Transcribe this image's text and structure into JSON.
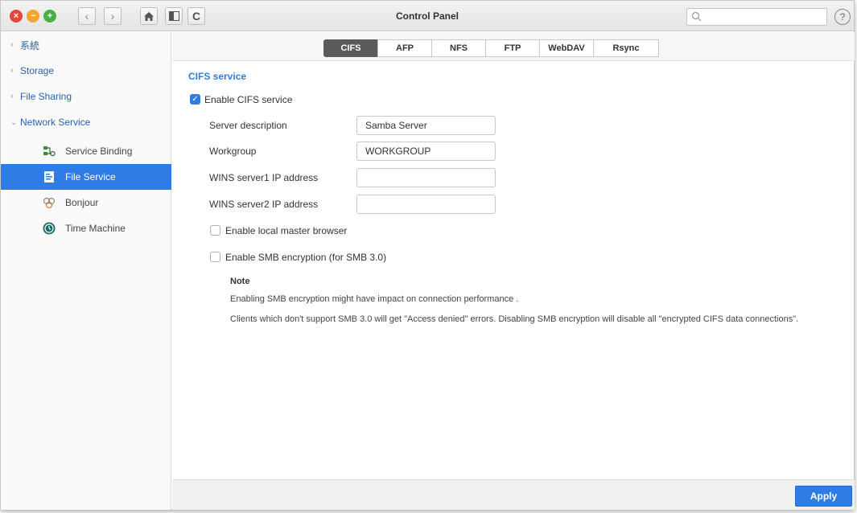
{
  "window": {
    "title": "Control Panel",
    "search_placeholder": "",
    "help_glyph": "?"
  },
  "titlebar": {
    "traffic": {
      "close": "×",
      "minimize": "−",
      "maximize": "+"
    },
    "buttons": {
      "back": "‹",
      "forward": "›",
      "refresh": "C"
    }
  },
  "sidebar": {
    "items": [
      {
        "label": "系統",
        "state": "collapsed"
      },
      {
        "label": "Storage",
        "state": "collapsed"
      },
      {
        "label": "File Sharing",
        "state": "collapsed"
      },
      {
        "label": "Network Service",
        "state": "expanded"
      }
    ],
    "subitems": [
      {
        "label": "Service Binding",
        "icon": "network-binding-icon",
        "active": false
      },
      {
        "label": "File Service",
        "icon": "file-service-icon",
        "active": true
      },
      {
        "label": "Bonjour",
        "icon": "bonjour-icon",
        "active": false
      },
      {
        "label": "Time Machine",
        "icon": "time-machine-icon",
        "active": false
      }
    ]
  },
  "tabs": [
    "CIFS",
    "AFP",
    "NFS",
    "FTP",
    "WebDAV",
    "Rsync"
  ],
  "active_tab": "CIFS",
  "main": {
    "section_title": "CIFS service",
    "enable_label": "Enable CIFS service",
    "enable_checked": true,
    "fields": {
      "server_description": {
        "label": "Server description",
        "value": "Samba Server"
      },
      "workgroup": {
        "label": "Workgroup",
        "value": "WORKGROUP"
      },
      "wins1": {
        "label": "WINS server1 IP address",
        "value": ""
      },
      "wins2": {
        "label": "WINS server2 IP address",
        "value": ""
      }
    },
    "local_master_label": "Enable local master browser",
    "local_master_checked": false,
    "smb_encryption_label": "Enable SMB encryption (for SMB 3.0)",
    "smb_encryption_checked": false,
    "note_title": "Note",
    "note_line1": "Enabling SMB encryption might have impact on connection performance .",
    "note_line2": "Clients which don't support SMB 3.0 will get \"Access denied\" errors. Disabling SMB encryption will disable all \"encrypted CIFS data connections\"."
  },
  "footer": {
    "apply_label": "Apply"
  },
  "colors": {
    "accent": "#2f7ce6",
    "sidebar_link": "#2663a8",
    "active_tab": "#5a5a5a"
  }
}
